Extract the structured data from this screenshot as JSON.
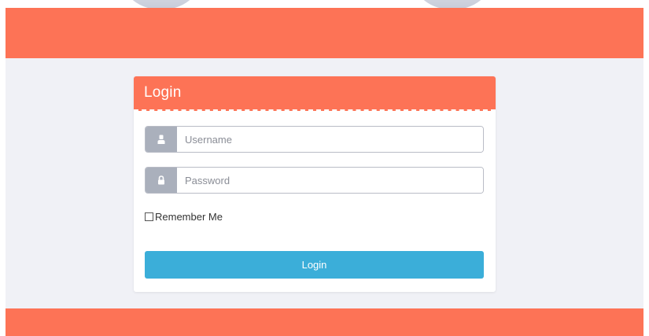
{
  "login": {
    "title": "Login",
    "username": {
      "placeholder": "Username",
      "value": ""
    },
    "password": {
      "placeholder": "Password",
      "value": ""
    },
    "remember_label": "Remember Me",
    "remember_checked": false,
    "submit_label": "Login"
  },
  "theme": {
    "accent": "#fd7356",
    "button": "#3baed9",
    "background": "#f0f1f6",
    "addon": "#aab0bc"
  },
  "icons": {
    "username": "user-icon",
    "password": "lock-icon"
  }
}
